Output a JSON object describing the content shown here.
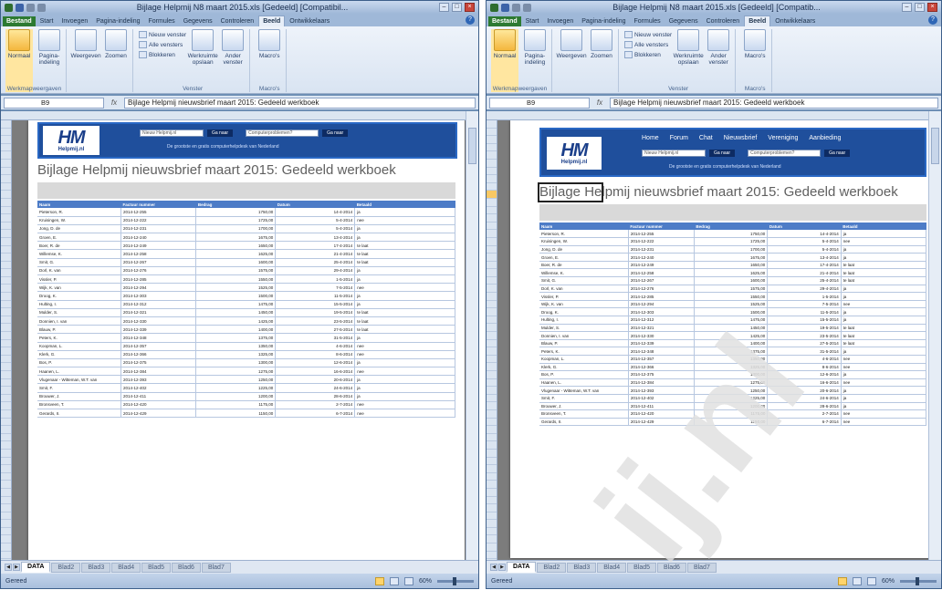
{
  "left": {
    "title": "Bijlage Helpmij N8 maart 2015.xls [Gedeeld] [Compatibil...",
    "tabs": [
      "Bestand",
      "Start",
      "Invoegen",
      "Pagina-indeling",
      "Formules",
      "Gegevens",
      "Controleren",
      "Beeld",
      "Ontwikkelaars"
    ],
    "ribbon": {
      "normaal": "Normaal",
      "pagina": "Pagina-indeling",
      "weergeven": "Weergeven",
      "zoomen": "Zoomen",
      "nieuw_venster": "Nieuw venster",
      "alle_vensters": "Alle vensters",
      "blokkeren": "Blokkeren",
      "werkruimte": "Werkruimte opslaan",
      "ander_venster": "Ander venster",
      "macros": "Macro's",
      "grp_weergaven": "Werkmapweergaven",
      "grp_venster": "Venster",
      "grp_macros": "Macro's"
    },
    "namebox": "B9",
    "formula": "Bijlage Helpmij nieuwsbrief maart 2015: Gedeeld werkboek",
    "status": "Gereed",
    "zoom": "60%",
    "sheet_tabs": [
      "DATA",
      "Blad2",
      "Blad3",
      "Blad4",
      "Blad5",
      "Blad6",
      "Blad7"
    ]
  },
  "right": {
    "title": "Bijlage Helpmij N8 maart 2015.xls [Gedeeld] [Compatib...",
    "tabs": [
      "Bestand",
      "Start",
      "Invoegen",
      "Pagina-indeling",
      "Formules",
      "Gegevens",
      "Controleren",
      "Beeld",
      "Ontwikkelaars"
    ],
    "ribbon": {
      "normaal": "Normaal",
      "pagina": "Pagina-indeling",
      "weergeven": "Weergeven",
      "zoomen": "Zoomen",
      "nieuw_venster": "Nieuw venster",
      "alle_vensters": "Alle vensters",
      "blokkeren": "Blokkeren",
      "werkruimte": "Werkruimte opslaan",
      "ander_venster": "Ander venster",
      "macros": "Macro's",
      "grp_weergaven": "Werkmapweergaven",
      "grp_venster": "Venster",
      "grp_macros": "Macro's"
    },
    "namebox": "B9",
    "formula": "Bijlage Helpmij nieuwsbrief maart 2015: Gedeeld werkboek",
    "status": "Gereed",
    "zoom": "60%",
    "sheet_tabs": [
      "DATA",
      "Blad2",
      "Blad3",
      "Blad4",
      "Blad5",
      "Blad6",
      "Blad7"
    ]
  },
  "doc": {
    "logo": "HM",
    "logo_domain": "Helpmij.nl",
    "nav": [
      "Home",
      "Forum",
      "Chat",
      "Nieuwsbrief",
      "Vereniging",
      "Aanbieding"
    ],
    "search1_placeholder": "Nieuw Helpmij.nl",
    "search1_btn": "Ga naar",
    "search2_placeholder": "Computerproblemen?",
    "search2_btn": "Ga naar",
    "tagline": "De grootste en gratis computerhelpdesk van Nederland",
    "title": "Bijlage Helpmij nieuwsbrief maart 2015: Gedeeld werkboek"
  },
  "table": {
    "headers": [
      "Naam",
      "Factuur nummer",
      "Bedrag",
      "Datum",
      "Betaald"
    ],
    "rows": [
      [
        "Pieterson, R.",
        "2014-12-255",
        "1750,00",
        "14-4-2014",
        "ja"
      ],
      [
        "Kruisingen, W.",
        "2014-12-222",
        "1725,00",
        "5-4-2014",
        "nee"
      ],
      [
        "Jong, D. de",
        "2014-12-231",
        "1700,00",
        "5-4-2014",
        "ja"
      ],
      [
        "Groen, E.",
        "2014-12-240",
        "1675,00",
        "13-4-2014",
        "ja"
      ],
      [
        "Boer, R. de",
        "2014-12-249",
        "1650,00",
        "17-4-2014",
        "te laat"
      ],
      [
        "Willemse, K.",
        "2014-12-258",
        "1625,00",
        "21-4-2014",
        "te laat"
      ],
      [
        "Smit, G.",
        "2014-12-267",
        "1600,00",
        "25-4-2014",
        "te laat"
      ],
      [
        "Dorl, K. van",
        "2014-12-276",
        "1575,00",
        "29-4-2014",
        "ja"
      ],
      [
        "Vissler, P.",
        "2014-12-285",
        "1550,00",
        "1-5-2014",
        "ja"
      ],
      [
        "Wijk, K. van",
        "2014-12-294",
        "1525,00",
        "7-5-2014",
        "nee"
      ],
      [
        "Droog, K.",
        "2014-12-303",
        "1500,00",
        "11-5-2014",
        "ja"
      ],
      [
        "Hulting, I.",
        "2014-12-312",
        "1475,00",
        "15-5-2014",
        "ja"
      ],
      [
        "Mulder, S.",
        "2014-12-321",
        "1450,00",
        "19-5-2014",
        "te laat"
      ],
      [
        "Donnien, I. van",
        "2014-12-330",
        "1425,00",
        "23-5-2014",
        "te laat"
      ],
      [
        "Blauw, P.",
        "2014-12-339",
        "1400,00",
        "27-5-2014",
        "te laat"
      ],
      [
        "Peters, K.",
        "2014-12-348",
        "1375,00",
        "31-5-2014",
        "ja"
      ],
      [
        "Koopman, L.",
        "2014-12-357",
        "1350,00",
        "4-6-2014",
        "nee"
      ],
      [
        "Klerk, G.",
        "2014-12-366",
        "1325,00",
        "8-6-2014",
        "nee"
      ],
      [
        "Bos, P.",
        "2014-12-375",
        "1300,00",
        "12-6-2014",
        "ja"
      ],
      [
        "Haanen, L.",
        "2014-12-384",
        "1275,00",
        "16-6-2014",
        "nee"
      ],
      [
        "Vlugenaar - Witteman, W.T. van",
        "2014-12-393",
        "1250,00",
        "20-6-2014",
        "ja"
      ],
      [
        "Smit, F.",
        "2014-12-402",
        "1225,00",
        "24-6-2014",
        "ja"
      ],
      [
        "Brouwer, J.",
        "2014-12-411",
        "1200,00",
        "28-6-2014",
        "ja"
      ],
      [
        "Bronsveen, T.",
        "2014-12-420",
        "1175,00",
        "2-7-2014",
        "nee"
      ],
      [
        "Gerards, II.",
        "2014-12-429",
        "1150,00",
        "6-7-2014",
        "nee"
      ]
    ]
  },
  "watermark": "ij.nl",
  "colors": {
    "file_tab": "#2d7a32",
    "banner": "#1f4f9c",
    "table_header": "#4d7cc7"
  }
}
